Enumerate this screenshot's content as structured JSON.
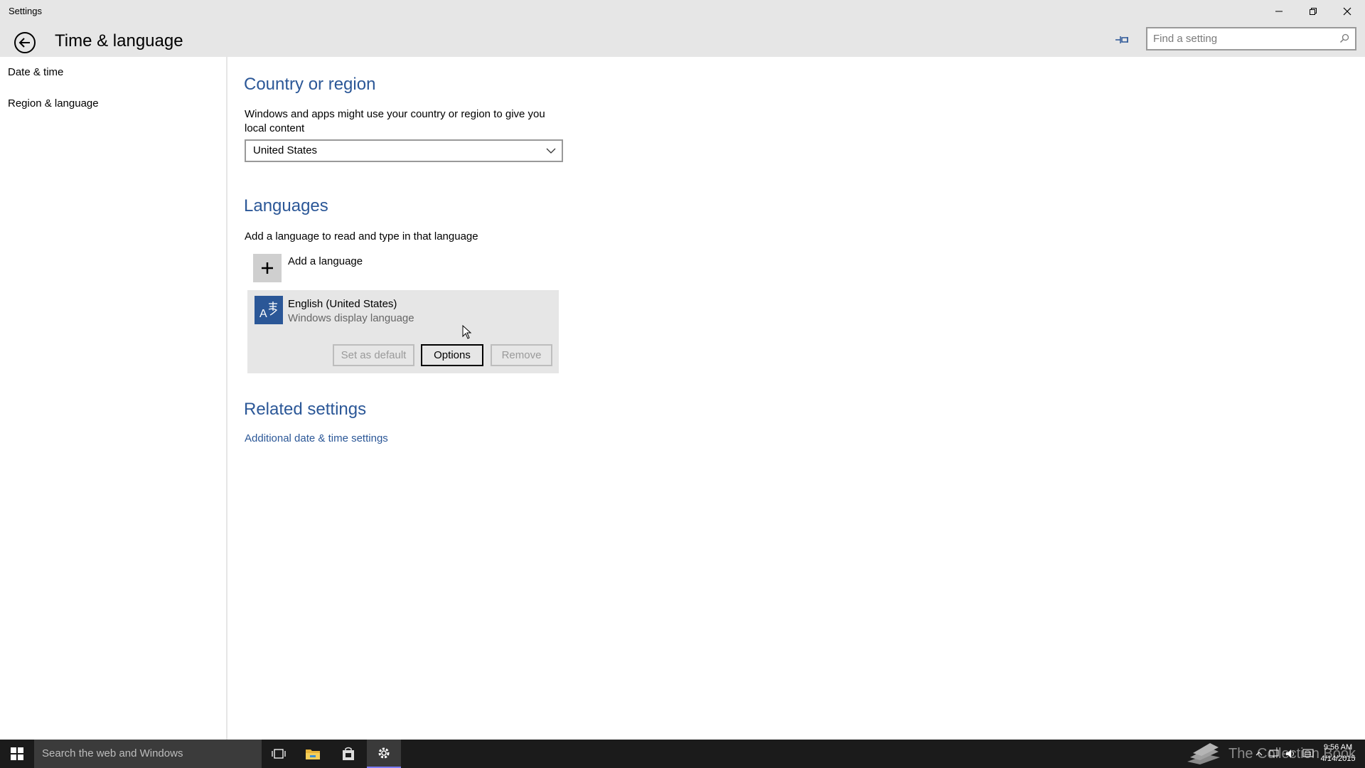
{
  "window": {
    "app_title": "Settings",
    "minimize_icon": "minimize-icon",
    "restore_icon": "restore-icon",
    "close_icon": "close-icon"
  },
  "header": {
    "title": "Time & language",
    "back_icon": "back-arrow-icon",
    "pin_icon": "pin-icon",
    "search_placeholder": "Find a setting",
    "search_value": ""
  },
  "sidebar": {
    "items": [
      {
        "label": "Date & time"
      },
      {
        "label": "Region & language"
      }
    ]
  },
  "main": {
    "country": {
      "heading": "Country or region",
      "description": "Windows and apps might use your country or region to give you local content",
      "selected": "United States"
    },
    "languages": {
      "heading": "Languages",
      "description": "Add a language to read and type in that language",
      "add_label": "Add a language",
      "items": [
        {
          "name": "English (United States)",
          "sub": "Windows display language"
        }
      ],
      "buttons": {
        "set_default": "Set as default",
        "options": "Options",
        "remove": "Remove"
      }
    },
    "related": {
      "heading": "Related settings",
      "link": "Additional date & time settings"
    }
  },
  "taskbar": {
    "search_placeholder": "Search the web and Windows",
    "watermark": "The Collection Book",
    "time": "9:56 AM",
    "date": "4/14/2015"
  },
  "colors": {
    "accent": "#2b5797",
    "chrome": "#e6e6e6",
    "taskbar": "#1b1b1b"
  }
}
